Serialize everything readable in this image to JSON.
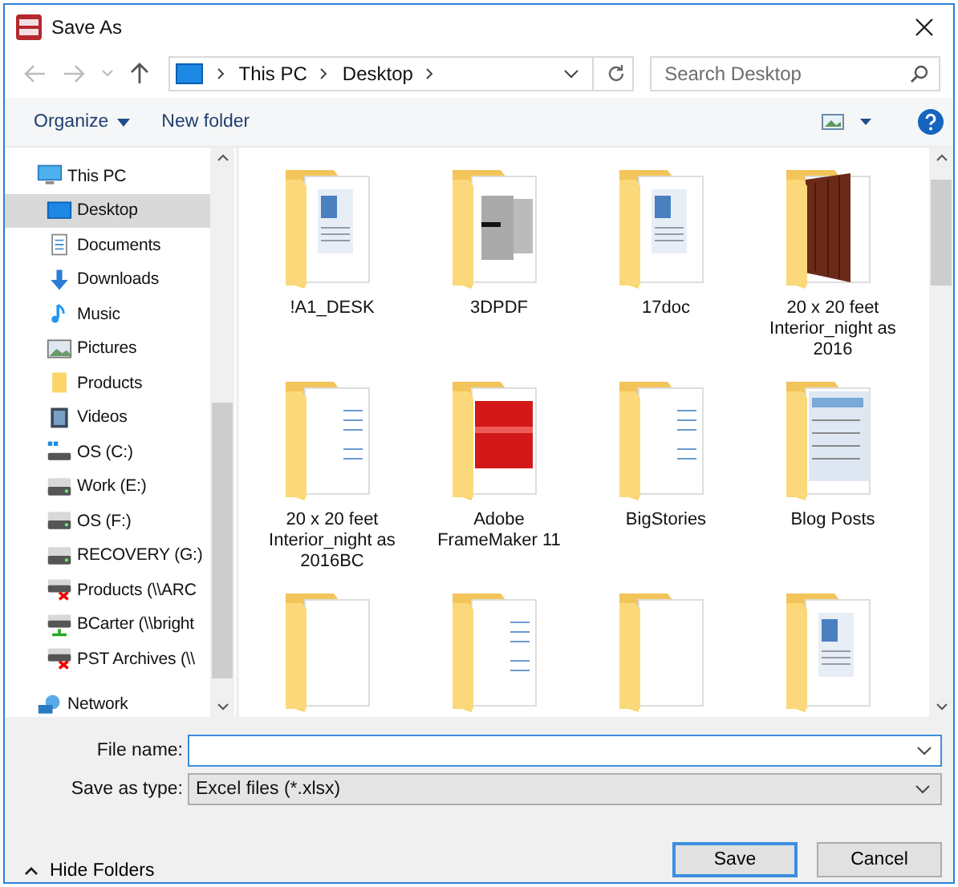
{
  "window": {
    "title": "Save As"
  },
  "breadcrumb": [
    "This PC",
    "Desktop"
  ],
  "search": {
    "placeholder": "Search Desktop"
  },
  "toolbar": {
    "organize": "Organize",
    "new_folder": "New folder"
  },
  "sidebar": {
    "items": [
      {
        "label": "This PC",
        "kind": "pc",
        "selected": false,
        "children": [
          {
            "label": "Desktop",
            "kind": "desktop",
            "selected": true
          },
          {
            "label": "Documents",
            "kind": "documents",
            "selected": false
          },
          {
            "label": "Downloads",
            "kind": "downloads",
            "selected": false
          },
          {
            "label": "Music",
            "kind": "music",
            "selected": false
          },
          {
            "label": "Pictures",
            "kind": "pictures",
            "selected": false
          },
          {
            "label": "Products",
            "kind": "folder",
            "selected": false
          },
          {
            "label": "Videos",
            "kind": "videos",
            "selected": false
          },
          {
            "label": "OS (C:)",
            "kind": "system-drive",
            "selected": false
          },
          {
            "label": "Work (E:)",
            "kind": "drive",
            "selected": false
          },
          {
            "label": "OS (F:)",
            "kind": "drive",
            "selected": false
          },
          {
            "label": "RECOVERY (G:)",
            "kind": "drive",
            "selected": false
          },
          {
            "label": "Products (\\\\ARC",
            "kind": "net-drive-off",
            "selected": false
          },
          {
            "label": "BCarter (\\\\bright",
            "kind": "net-drive-on",
            "selected": false
          },
          {
            "label": "PST Archives (\\\\",
            "kind": "net-drive-off",
            "selected": false
          }
        ]
      },
      {
        "label": "Network",
        "kind": "network",
        "selected": false
      }
    ]
  },
  "files": [
    {
      "name": "!A1_DESK",
      "kind": "document"
    },
    {
      "name": "3DPDF",
      "kind": "gray"
    },
    {
      "name": "17doc",
      "kind": "document"
    },
    {
      "name": "20 x 20 feet Interior_night as 2016",
      "kind": "wood"
    },
    {
      "name": "20 x 20 feet Interior_night as 2016BC",
      "kind": "lines"
    },
    {
      "name": "Adobe FrameMaker 11",
      "kind": "red"
    },
    {
      "name": "BigStories",
      "kind": "lines"
    },
    {
      "name": "Blog Posts",
      "kind": "screen"
    },
    {
      "kind": "blank"
    },
    {
      "kind": "lines"
    },
    {
      "kind": "blank"
    },
    {
      "kind": "document"
    }
  ],
  "file_name": {
    "label": "File name:"
  },
  "save_as_type": {
    "label": "Save as type:",
    "value": "Excel files (*.xlsx)"
  },
  "hide_folders": "Hide Folders",
  "buttons": {
    "save": "Save",
    "cancel": "Cancel"
  }
}
